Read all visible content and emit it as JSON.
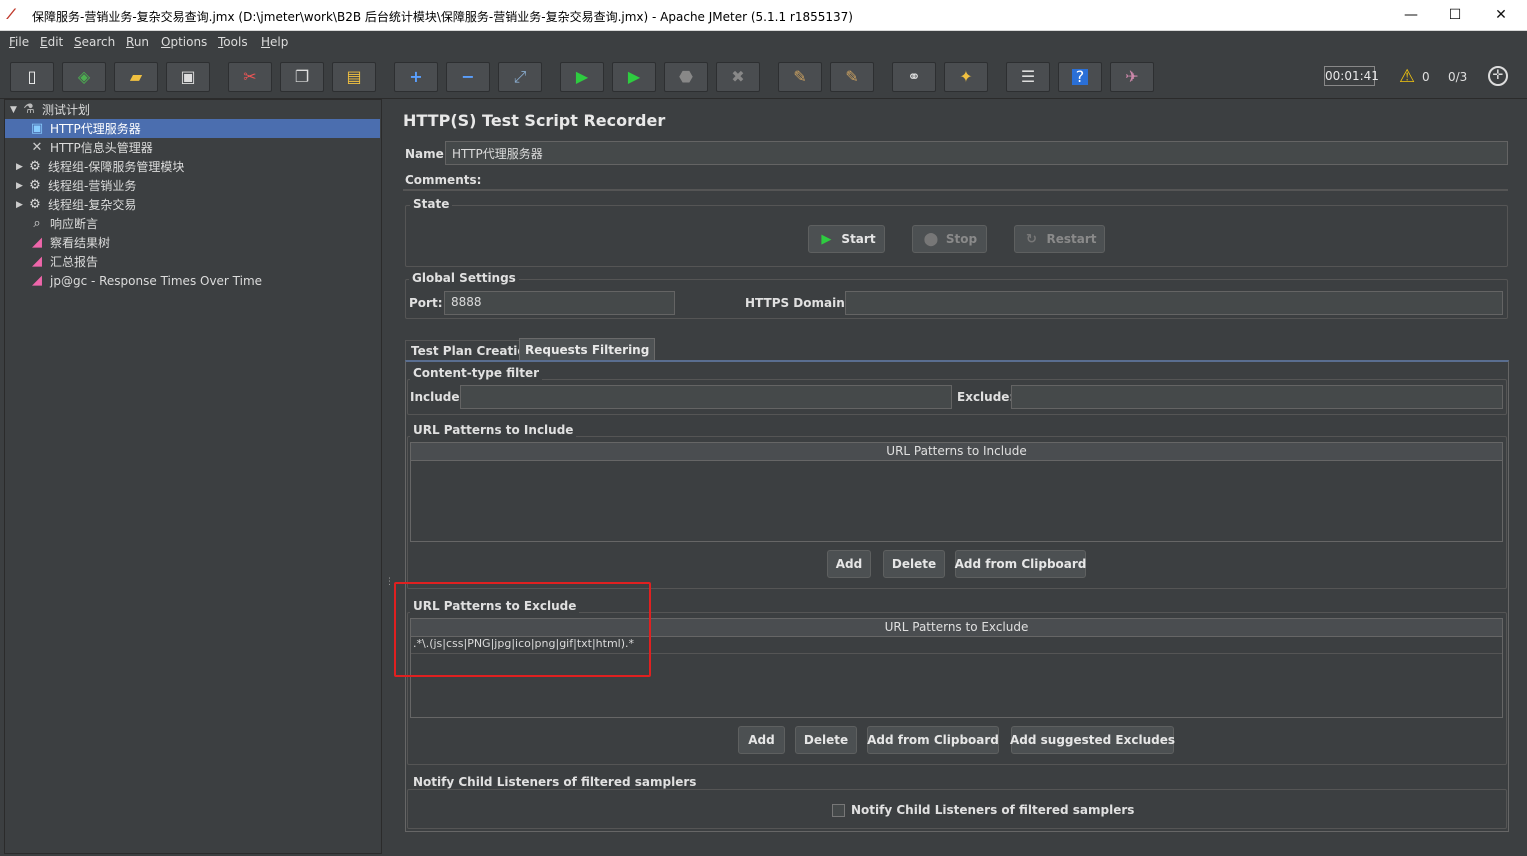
{
  "window": {
    "title": "保障服务-营销业务-复杂交易查询.jmx (D:\\jmeter\\work\\B2B 后台统计模块\\保障服务-营销业务-复杂交易查询.jmx) - Apache JMeter (5.1.1 r1855137)",
    "minimize": "—",
    "maximize": "☐",
    "close": "✕"
  },
  "menu": [
    "File",
    "Edit",
    "Search",
    "Run",
    "Options",
    "Tools",
    "Help"
  ],
  "toolbar": {
    "timer": "00:01:41",
    "warnings": "0",
    "threads": "0/3"
  },
  "tree": {
    "root": "测试计划",
    "items": [
      "HTTP代理服务器",
      "HTTP信息头管理器",
      "线程组-保障服务管理模块",
      "线程组-营销业务",
      "线程组-复杂交易",
      "响应断言",
      "察看结果树",
      "汇总报告",
      "jp@gc - Response Times Over Time"
    ]
  },
  "panel": {
    "title": "HTTP(S) Test Script Recorder",
    "name_label": "Name:",
    "name_value": "HTTP代理服务器",
    "comments_label": "Comments:",
    "state": {
      "title": "State",
      "start": "Start",
      "stop": "Stop",
      "restart": "Restart"
    },
    "global": {
      "title": "Global Settings",
      "port_label": "Port:",
      "port_value": "8888",
      "https_label": "HTTPS Domains:",
      "https_value": ""
    },
    "tabs": [
      "Test Plan Creation",
      "Requests Filtering"
    ],
    "content_filter": {
      "title": "Content-type filter",
      "include_label": "Include:",
      "exclude_label": "Exclude:"
    },
    "include_patterns": {
      "title": "URL Patterns to Include",
      "header": "URL Patterns to Include",
      "rows": [],
      "add": "Add",
      "delete": "Delete",
      "clipboard": "Add from Clipboard"
    },
    "exclude_patterns": {
      "title": "URL Patterns to Exclude",
      "header": "URL Patterns to Exclude",
      "rows": [
        ".*\\.(js|css|PNG|jpg|ico|png|gif|txt|html).*"
      ],
      "add": "Add",
      "delete": "Delete",
      "clipboard": "Add from Clipboard",
      "suggested": "Add suggested Excludes"
    },
    "notify": {
      "title": "Notify Child Listeners of filtered samplers",
      "checkbox_label": "Notify Child Listeners of filtered samplers",
      "checked": false
    }
  },
  "colors": {
    "background": "#3c3f41",
    "selection": "#4b6eaf",
    "highlight_box": "#e02020"
  }
}
